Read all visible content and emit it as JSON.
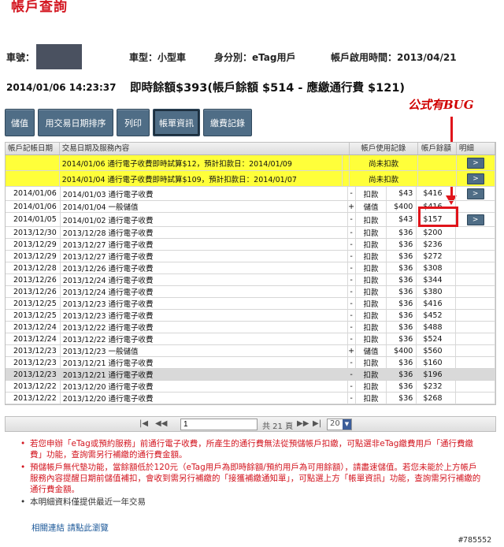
{
  "page_title": "帳戶查詢",
  "info": {
    "account_label": "車號：",
    "vehicle_type": "車型：小型車",
    "identity": "身分別：eTag用戶",
    "activation": "帳戶啟用時間：2013/04/21"
  },
  "balance": {
    "timestamp": "2014/01/06 14:23:37",
    "summary": "即時餘額$393(帳戶餘額 $514 - 應繳通行費 $121)"
  },
  "annotation": "公式有BUG",
  "toolbar": [
    {
      "label": "儲值"
    },
    {
      "label": "用交易日期排序"
    },
    {
      "label": "列印"
    },
    {
      "label": "帳單資訊"
    },
    {
      "label": "繳費記錄"
    }
  ],
  "columns": {
    "date": "帳戶記帳日期",
    "desc": "交易日期及服務內容",
    "usage": "帳戶使用記錄",
    "balance": "帳戶餘額",
    "detail": "明細"
  },
  "pending_rows": [
    {
      "desc": "2014/01/06 通行電子收費即時試算$12，預計扣款日：2014/01/09",
      "status": "尚未扣款",
      "detail": ">"
    },
    {
      "desc": "2014/01/04 通行電子收費即時試算$109，預計扣款日：2014/01/07",
      "status": "尚未扣款",
      "detail": ">"
    }
  ],
  "rows": [
    {
      "date": "2014/01/06",
      "desc": "2014/01/03 通行電子收費",
      "sign": "-",
      "kind": "扣款",
      "amount": "$43",
      "balance": "$416",
      "detail": ">"
    },
    {
      "date": "2014/01/06",
      "desc": "2014/01/04 一般儲值",
      "sign": "+",
      "kind": "儲值",
      "amount": "$400",
      "balance": "$416",
      "detail": ""
    },
    {
      "date": "2014/01/05",
      "desc": "2014/01/02 通行電子收費",
      "sign": "-",
      "kind": "扣款",
      "amount": "$43",
      "balance": "$157",
      "detail": ">"
    },
    {
      "date": "2013/12/30",
      "desc": "2013/12/28 通行電子收費",
      "sign": "-",
      "kind": "扣款",
      "amount": "$36",
      "balance": "$200",
      "detail": ""
    },
    {
      "date": "2013/12/29",
      "desc": "2013/12/27 通行電子收費",
      "sign": "-",
      "kind": "扣款",
      "amount": "$36",
      "balance": "$236",
      "detail": ""
    },
    {
      "date": "2013/12/29",
      "desc": "2013/12/27 通行電子收費",
      "sign": "-",
      "kind": "扣款",
      "amount": "$36",
      "balance": "$272",
      "detail": ""
    },
    {
      "date": "2013/12/28",
      "desc": "2013/12/26 通行電子收費",
      "sign": "-",
      "kind": "扣款",
      "amount": "$36",
      "balance": "$308",
      "detail": ""
    },
    {
      "date": "2013/12/26",
      "desc": "2013/12/24 通行電子收費",
      "sign": "-",
      "kind": "扣款",
      "amount": "$36",
      "balance": "$344",
      "detail": ""
    },
    {
      "date": "2013/12/26",
      "desc": "2013/12/24 通行電子收費",
      "sign": "-",
      "kind": "扣款",
      "amount": "$36",
      "balance": "$380",
      "detail": ""
    },
    {
      "date": "2013/12/25",
      "desc": "2013/12/23 通行電子收費",
      "sign": "-",
      "kind": "扣款",
      "amount": "$36",
      "balance": "$416",
      "detail": ""
    },
    {
      "date": "2013/12/25",
      "desc": "2013/12/23 通行電子收費",
      "sign": "-",
      "kind": "扣款",
      "amount": "$36",
      "balance": "$452",
      "detail": ""
    },
    {
      "date": "2013/12/24",
      "desc": "2013/12/22 通行電子收費",
      "sign": "-",
      "kind": "扣款",
      "amount": "$36",
      "balance": "$488",
      "detail": ""
    },
    {
      "date": "2013/12/24",
      "desc": "2013/12/22 通行電子收費",
      "sign": "-",
      "kind": "扣款",
      "amount": "$36",
      "balance": "$524",
      "detail": ""
    },
    {
      "date": "2013/12/23",
      "desc": "2013/12/23 一般儲值",
      "sign": "+",
      "kind": "儲值",
      "amount": "$400",
      "balance": "$560",
      "detail": ""
    },
    {
      "date": "2013/12/23",
      "desc": "2013/12/21 通行電子收費",
      "sign": "-",
      "kind": "扣款",
      "amount": "$36",
      "balance": "$160",
      "detail": ""
    },
    {
      "date": "2013/12/23",
      "desc": "2013/12/21 通行電子收費",
      "sign": "-",
      "kind": "扣款",
      "amount": "$36",
      "balance": "$196",
      "detail": ""
    },
    {
      "date": "2013/12/22",
      "desc": "2013/12/20 通行電子收費",
      "sign": "-",
      "kind": "扣款",
      "amount": "$36",
      "balance": "$232",
      "detail": ""
    },
    {
      "date": "2013/12/22",
      "desc": "2013/12/20 通行電子收費",
      "sign": "-",
      "kind": "扣款",
      "amount": "$36",
      "balance": "$268",
      "detail": ""
    }
  ],
  "selected_row_index": 15,
  "highlight_row_index": 1,
  "pager": {
    "first": "|◀",
    "prev": "◀◀",
    "page_value": "1",
    "total": "共 21 頁",
    "next": "▶▶",
    "last": "▶|",
    "page_size": "20"
  },
  "notes": [
    "若您申辦「eTag或預約服務」前通行電子收費，所產生的通行費無法從預儲帳戶扣繳，可點選非eTag繳費用戶「通行費繳費」功能，查詢需另行補繳的通行費金額。",
    "預儲帳戶無代墊功能，當餘額低於120元（eTag用戶為即時餘額/預約用戶為可用餘額），請盡速儲值。若您未能於上方帳戶服務內容提醒日期前儲值補扣，會收到需另行補繳的「接獲補繳通知單」，可點選上方「帳單資訊」功能，查詢需另行補繳的通行費金額。",
    "本明細資料僅提供最近一年交易"
  ],
  "related_link": "相關連結 請點此瀏覽",
  "watermark": "#785552"
}
